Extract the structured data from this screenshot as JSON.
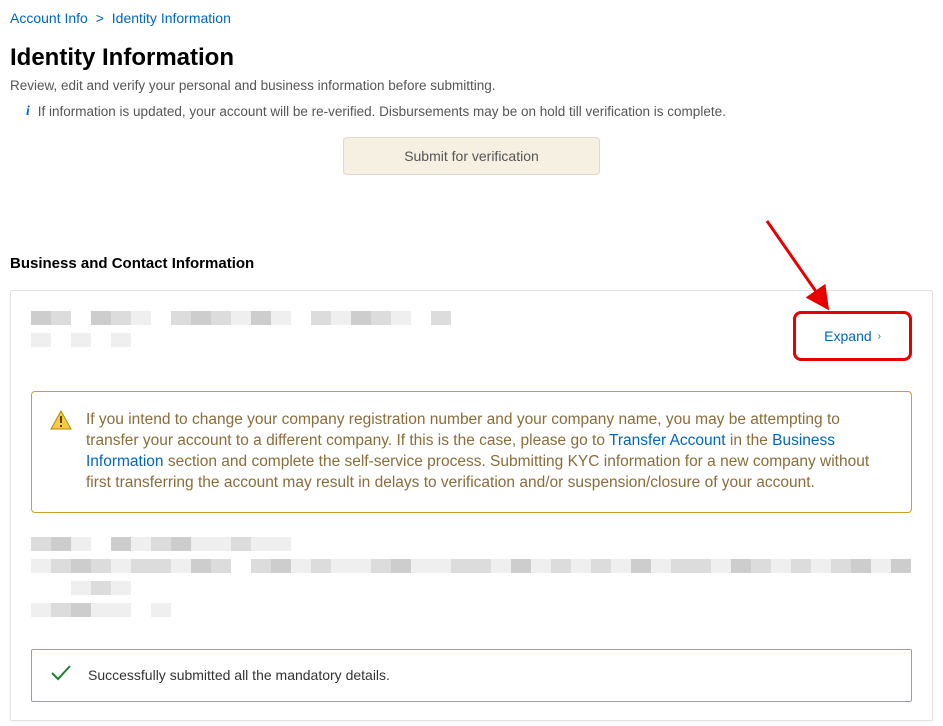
{
  "breadcrumb": {
    "root": "Account Info",
    "sep": ">",
    "current": "Identity Information"
  },
  "header": {
    "title": "Identity Information",
    "subtitle": "Review, edit and verify your personal and business information before submitting.",
    "info_note": "If information is updated, your account will be re-verified. Disbursements may be on hold till verification is complete."
  },
  "actions": {
    "submit_label": "Submit for verification"
  },
  "section": {
    "title": "Business and Contact Information",
    "expand_label": "Expand",
    "warning_parts": {
      "p1": "If you intend to change your company registration number and your company name, you may be attempting to transfer your account to a different company. If this is the case, please go to ",
      "link1": "Transfer Account",
      "p2": " in the ",
      "link2": "Business Information",
      "p3": " section and complete the self-service process. Submitting KYC information for a new company without first transferring the account may result in delays to verification and/or suspension/closure of your account."
    },
    "success_msg": "Successfully submitted all the mandatory details."
  }
}
